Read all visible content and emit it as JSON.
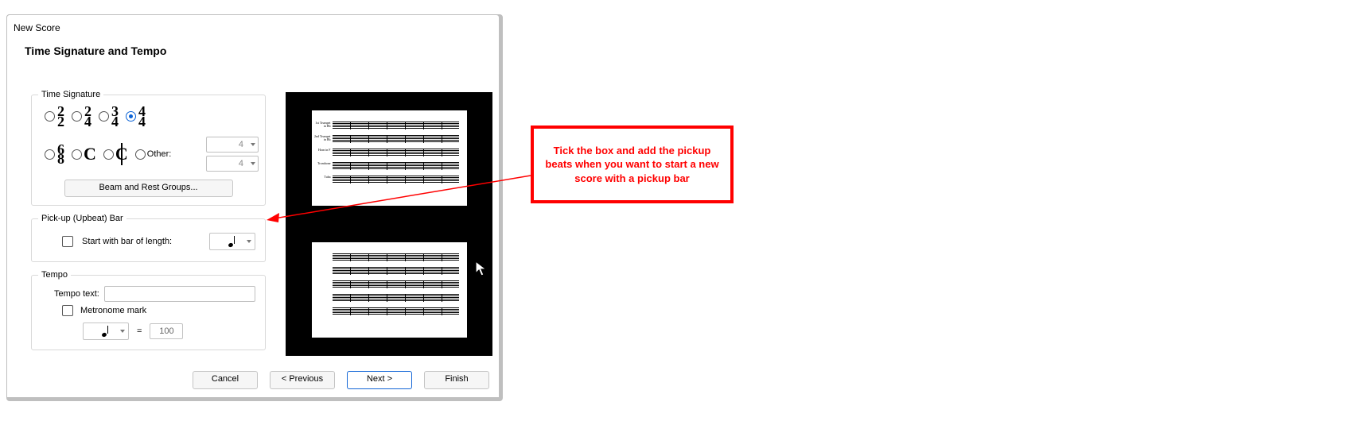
{
  "window": {
    "title": "New Score"
  },
  "heading": "Time Signature and Tempo",
  "time_sig": {
    "legend": "Time Signature",
    "opt_2_2_top": "2",
    "opt_2_2_bot": "2",
    "opt_2_4_top": "2",
    "opt_2_4_bot": "4",
    "opt_3_4_top": "3",
    "opt_3_4_bot": "4",
    "opt_4_4_top": "4",
    "opt_4_4_bot": "4",
    "opt_6_8_top": "6",
    "opt_6_8_bot": "8",
    "glyph_C": "C",
    "glyph_Ccut": "C",
    "other_label": "Other:",
    "other_num": "4",
    "other_den": "4",
    "beam_button": "Beam and Rest Groups..."
  },
  "pickup": {
    "legend": "Pick-up (Upbeat) Bar",
    "checkbox_label": "Start with bar of length:"
  },
  "tempo": {
    "legend": "Tempo",
    "text_label": "Tempo text:",
    "metronome_label": "Metronome mark",
    "equals": "=",
    "bpm": "100"
  },
  "preview": {
    "parts": [
      "1st Trumpet in Bb",
      "2nd Trumpet in Bb",
      "Horn in F",
      "Trombone",
      "Tuba"
    ]
  },
  "buttons": {
    "cancel": "Cancel",
    "previous": "< Previous",
    "next": "Next >",
    "finish": "Finish"
  },
  "annotation": {
    "text": "Tick the box and add the pickup beats when you want to start a new score with a pickup bar"
  }
}
